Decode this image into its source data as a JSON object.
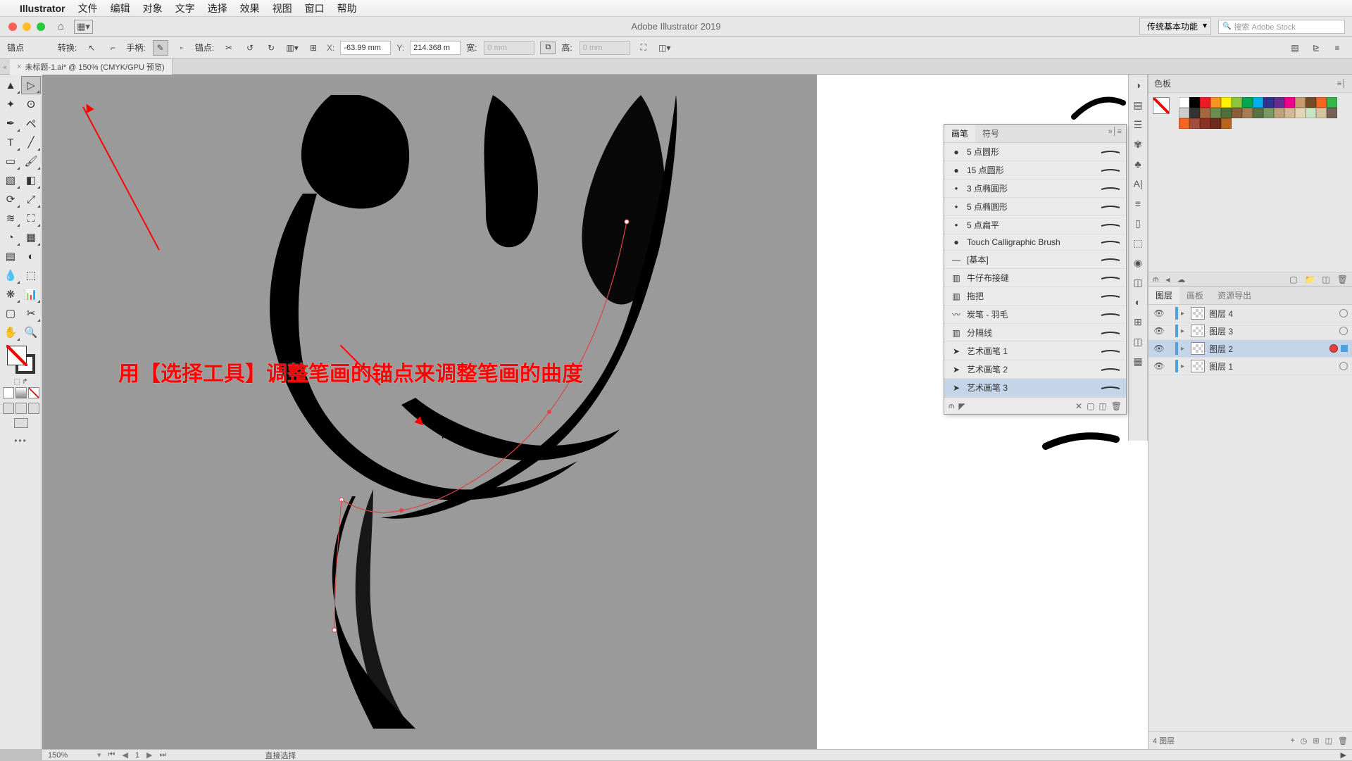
{
  "menu": {
    "app": "Illustrator",
    "items": [
      "文件",
      "编辑",
      "对象",
      "文字",
      "选择",
      "效果",
      "视图",
      "窗口",
      "帮助"
    ]
  },
  "title": "Adobe Illustrator 2019",
  "workspace": "传统基本功能",
  "search_placeholder": "搜索 Adobe Stock",
  "options": {
    "anchor_label": "锚点",
    "transform_label": "转换:",
    "handle_label": "手柄:",
    "anchor2_label": "锚点:",
    "x": "-63.99 mm",
    "y": "214.368 m",
    "w_label": "宽:",
    "w": "0 mm",
    "h_label": "高:",
    "h": "0 mm"
  },
  "doc_tab": "未标题-1.ai* @ 150% (CMYK/GPU 预览)",
  "annotation": "用【选择工具】调整笔画的锚点来调整笔画的曲度",
  "brush_panel": {
    "tab1": "画笔",
    "tab2": "符号",
    "items": [
      {
        "name": "5 点圆形",
        "type": "dot"
      },
      {
        "name": "15 点圆形",
        "type": "dot"
      },
      {
        "name": "3 点椭圆形",
        "type": "smalldot"
      },
      {
        "name": "5 点椭圆形",
        "type": "smalldot"
      },
      {
        "name": "5 点扁平",
        "type": "smalldot"
      },
      {
        "name": "Touch Calligraphic Brush",
        "type": "dot"
      },
      {
        "name": "[基本]",
        "type": "none"
      },
      {
        "name": "牛仔布接缝",
        "type": "pattern"
      },
      {
        "name": "拖把",
        "type": "pattern"
      },
      {
        "name": "炭笔 - 羽毛",
        "type": "stroke"
      },
      {
        "name": "分隔线",
        "type": "pattern"
      },
      {
        "name": "艺术画笔 1",
        "type": "art"
      },
      {
        "name": "艺术画笔 2",
        "type": "art"
      },
      {
        "name": "艺术画笔 3",
        "type": "art",
        "selected": true
      }
    ]
  },
  "swatches_title": "色板",
  "layers": {
    "tab1": "图层",
    "tab2": "画板",
    "tab3": "资源导出",
    "rows": [
      {
        "name": "图层 4",
        "color": "#4aa3df"
      },
      {
        "name": "图层 3",
        "color": "#4aa3df"
      },
      {
        "name": "图层 2",
        "color": "#4aa3df",
        "selected": true,
        "target": true
      },
      {
        "name": "图层 1",
        "color": "#4aa3df"
      }
    ],
    "footer": "4 图层"
  },
  "status": {
    "zoom": "150%",
    "page": "1",
    "tool": "直接选择"
  },
  "swatch_colors": [
    [
      "#ffffff",
      "#000000",
      "#ed1c24",
      "#f7931e",
      "#fff200",
      "#8cc63f",
      "#00a651",
      "#00aeef",
      "#2e3192",
      "#662d91",
      "#ec008c",
      "#c69c6d",
      "#754c24",
      "#f26522",
      "#39b54a"
    ],
    [
      "#cccccc",
      "#333333",
      "#a6673f",
      "#6b8e4e",
      "#4f6e3a",
      "#8a5d3b",
      "#a67c52",
      "#5a7247",
      "#7a9a65",
      "#bda17a",
      "#d4b896",
      "#e5d5b5",
      "#c9e4c5",
      "#d8c4a0",
      "#736357"
    ],
    [
      "#f26522",
      "#a24e3d",
      "#8a3324",
      "#6e2a1e",
      "#b5651d"
    ]
  ]
}
